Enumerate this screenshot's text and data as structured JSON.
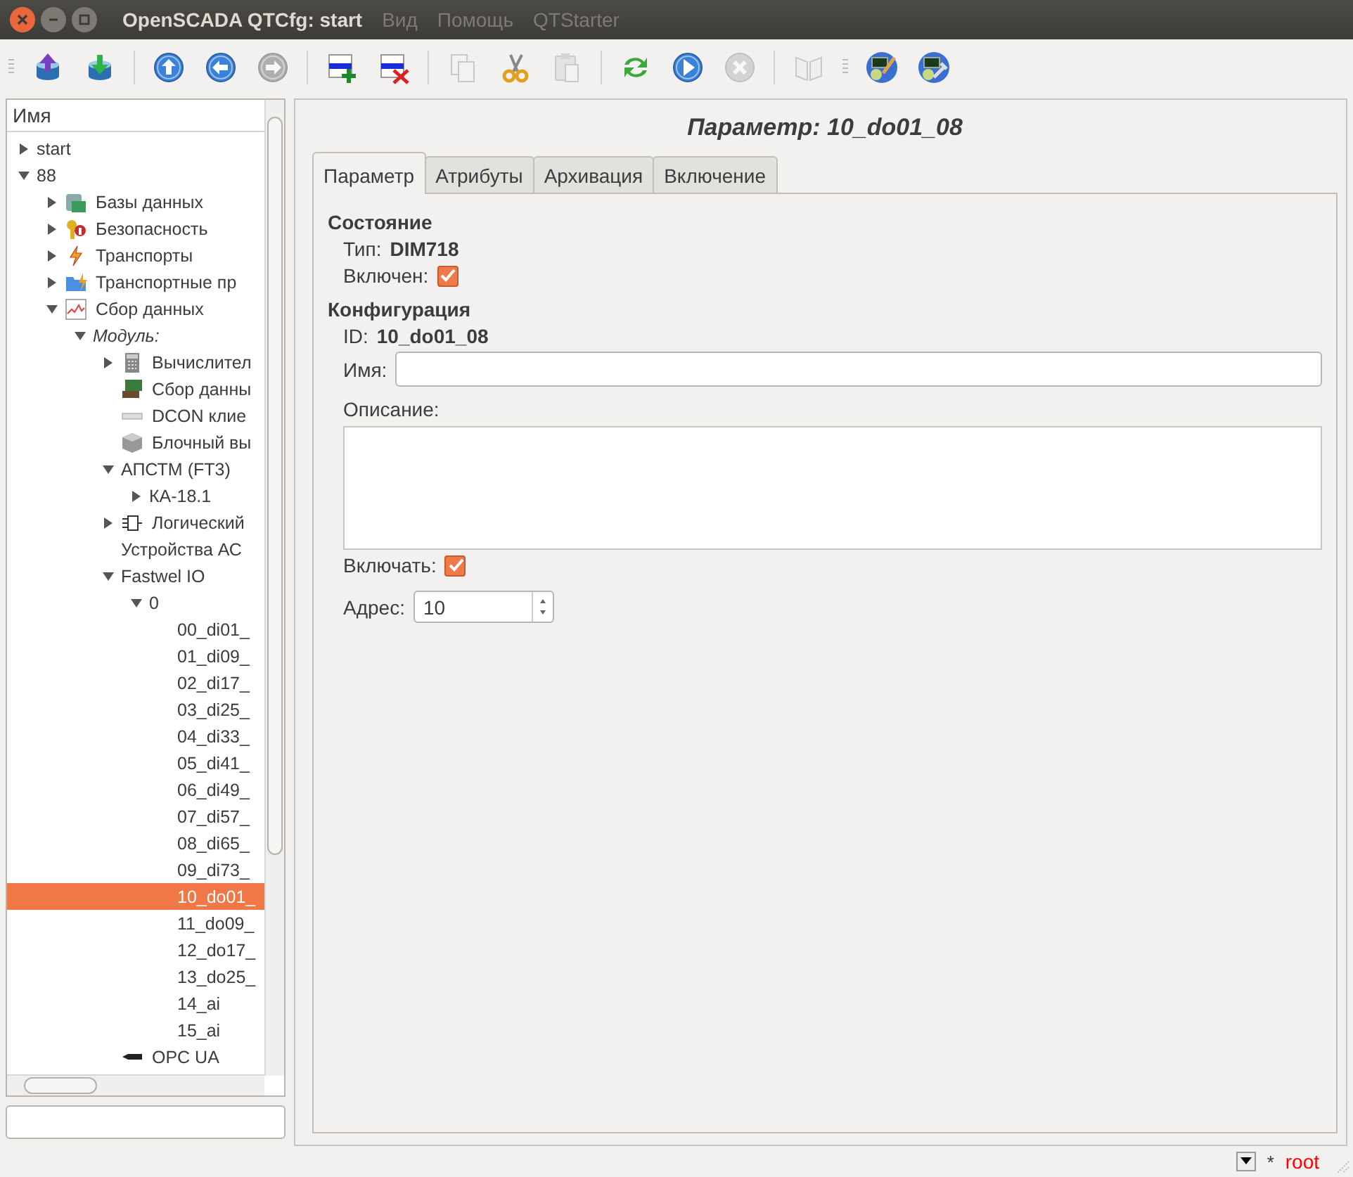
{
  "window": {
    "title": "OpenSCADA QTCfg: start"
  },
  "menu": [
    "Вид",
    "Помощь",
    "QTStarter"
  ],
  "toolbar": [
    {
      "kind": "db-up",
      "disabled": false
    },
    {
      "kind": "db-down",
      "disabled": false
    },
    {
      "kind": "sep"
    },
    {
      "kind": "up",
      "disabled": false
    },
    {
      "kind": "back",
      "disabled": false
    },
    {
      "kind": "forward",
      "disabled": true
    },
    {
      "kind": "sep"
    },
    {
      "kind": "add",
      "disabled": false
    },
    {
      "kind": "delete",
      "disabled": false
    },
    {
      "kind": "sep"
    },
    {
      "kind": "copy",
      "disabled": true
    },
    {
      "kind": "cut",
      "disabled": false
    },
    {
      "kind": "paste",
      "disabled": true
    },
    {
      "kind": "sep"
    },
    {
      "kind": "refresh",
      "disabled": false
    },
    {
      "kind": "start",
      "disabled": false
    },
    {
      "kind": "stop",
      "disabled": true
    },
    {
      "kind": "sep"
    },
    {
      "kind": "book",
      "disabled": true
    },
    {
      "kind": "handle"
    },
    {
      "kind": "app-edit",
      "disabled": false
    },
    {
      "kind": "app-tool",
      "disabled": false
    }
  ],
  "tree": {
    "header": "Имя",
    "items": [
      {
        "label": "start",
        "expanded": false,
        "selected": false
      },
      {
        "label": "88",
        "expanded": true,
        "selected": false,
        "children": [
          {
            "label": "Базы данных",
            "kind": "db",
            "expanded": false,
            "selected": false
          },
          {
            "label": "Безопасность",
            "kind": "security",
            "expanded": false,
            "selected": false
          },
          {
            "label": "Транспорты",
            "kind": "transport",
            "expanded": false,
            "selected": false
          },
          {
            "label": "Транспортные пр",
            "kind": "folder",
            "expanded": false,
            "selected": false
          },
          {
            "label": "Сбор данных",
            "kind": "chart",
            "expanded": true,
            "selected": false,
            "children": [
              {
                "label": "Модуль:",
                "kind": "group",
                "expanded": true,
                "selected": false,
                "children": [
                  {
                    "label": "Вычислител",
                    "kind": "calculator",
                    "expanded": false,
                    "selected": false
                  },
                  {
                    "label": "Сбор данны",
                    "kind": "daq",
                    "selected": false
                  },
                  {
                    "label": "DCON клие",
                    "kind": "dcon",
                    "selected": false
                  },
                  {
                    "label": "Блочный вы",
                    "kind": "cube",
                    "selected": false
                  },
                  {
                    "label": "АПСТМ (FT3)",
                    "expanded": true,
                    "selected": false,
                    "children": [
                      {
                        "label": "КА-18.1",
                        "expanded": false,
                        "selected": false
                      }
                    ]
                  },
                  {
                    "label": "Логический",
                    "kind": "logic",
                    "expanded": false,
                    "selected": false
                  },
                  {
                    "label": "Устройства АС",
                    "selected": false
                  },
                  {
                    "label": "Fastwel IO",
                    "expanded": true,
                    "selected": false,
                    "children": [
                      {
                        "label": "0",
                        "expanded": true,
                        "selected": false,
                        "children": [
                          {
                            "label": "00_di01_",
                            "selected": false
                          },
                          {
                            "label": "01_di09_",
                            "selected": false
                          },
                          {
                            "label": "02_di17_",
                            "selected": false
                          },
                          {
                            "label": "03_di25_",
                            "selected": false
                          },
                          {
                            "label": "04_di33_",
                            "selected": false
                          },
                          {
                            "label": "05_di41_",
                            "selected": false
                          },
                          {
                            "label": "06_di49_",
                            "selected": false
                          },
                          {
                            "label": "07_di57_",
                            "selected": false
                          },
                          {
                            "label": "08_di65_",
                            "selected": false
                          },
                          {
                            "label": "09_di73_",
                            "selected": false
                          },
                          {
                            "label": "10_do01_",
                            "selected": true
                          },
                          {
                            "label": "11_do09_",
                            "selected": false
                          },
                          {
                            "label": "12_do17_",
                            "selected": false
                          },
                          {
                            "label": "13_do25_",
                            "selected": false
                          },
                          {
                            "label": "14_ai",
                            "selected": false
                          },
                          {
                            "label": "15_ai",
                            "selected": false
                          }
                        ]
                      }
                    ]
                  },
                  {
                    "label": "OPC UA",
                    "kind": "opc",
                    "selected": false
                  }
                ]
              }
            ]
          }
        ]
      }
    ]
  },
  "page": {
    "title": "Параметр: 10_do01_08",
    "tabs": [
      {
        "label": "Параметр",
        "selected": true
      },
      {
        "label": "Атрибуты",
        "selected": false
      },
      {
        "label": "Архивация",
        "selected": false
      },
      {
        "label": "Включение",
        "selected": false
      }
    ],
    "sections": [
      {
        "title": "Состояние",
        "fields": [
          {
            "kind": "text",
            "label": "Тип:",
            "value": "DIM718"
          },
          {
            "kind": "checkbox",
            "label": "Включен:",
            "checked": true
          }
        ]
      },
      {
        "title": "Конфигурация",
        "fields": [
          {
            "kind": "text",
            "label": "ID:",
            "value": "10_do01_08"
          },
          {
            "kind": "input",
            "label": "Имя:"
          },
          {
            "kind": "textarea",
            "label": "Описание:"
          },
          {
            "kind": "checkbox",
            "label": "Включать:",
            "checked": true
          },
          {
            "kind": "spin",
            "label": "Адрес:",
            "value": "10"
          }
        ]
      }
    ]
  },
  "status_bar": {
    "modified": "*",
    "user": "root"
  }
}
